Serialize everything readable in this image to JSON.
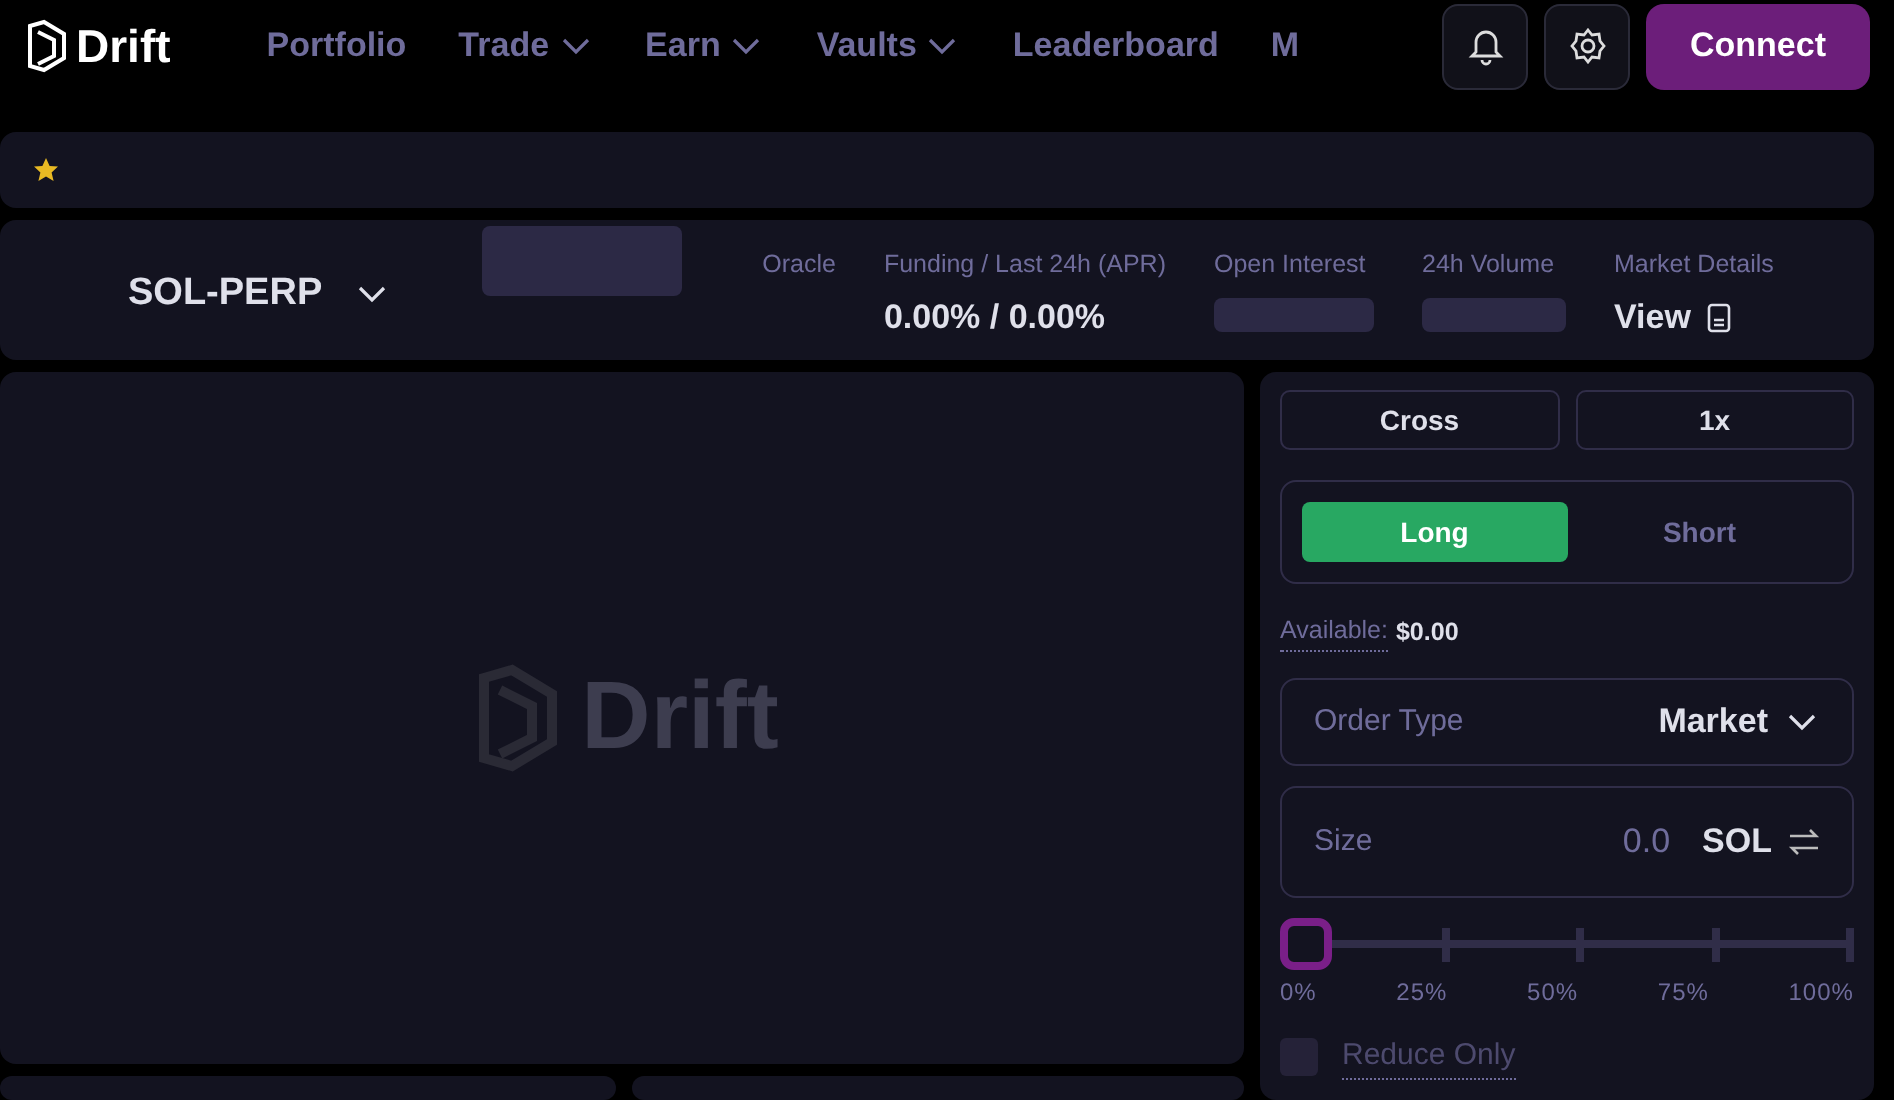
{
  "header": {
    "logo": "Drift",
    "nav": [
      {
        "label": "Portfolio",
        "dropdown": false
      },
      {
        "label": "Trade",
        "dropdown": true
      },
      {
        "label": "Earn",
        "dropdown": true
      },
      {
        "label": "Vaults",
        "dropdown": true
      },
      {
        "label": "Leaderboard",
        "dropdown": false
      },
      {
        "label": "M",
        "dropdown": false
      }
    ],
    "connect": "Connect"
  },
  "favorites_bar": {
    "starred": true
  },
  "market_bar": {
    "market": "SOL-PERP",
    "stats": [
      {
        "label": "Oracle",
        "kind": "empty"
      },
      {
        "label": "Funding / Last 24h (APR)",
        "kind": "value",
        "value": "0.00% / 0.00%"
      },
      {
        "label": "Open Interest",
        "kind": "loading"
      },
      {
        "label": "24h Volume",
        "kind": "loading"
      },
      {
        "label": "Market Details",
        "kind": "link",
        "value": "View"
      }
    ]
  },
  "chart": {
    "watermark": "Drift"
  },
  "trade_panel": {
    "margin_mode": "Cross",
    "leverage": "1x",
    "sides": [
      {
        "label": "Long",
        "selected": true
      },
      {
        "label": "Short",
        "selected": false
      }
    ],
    "available_label": "Available:",
    "available_value": "$0.00",
    "order_type_label": "Order Type",
    "order_type": "Market",
    "size_label": "Size",
    "size_value": "0.0",
    "size_unit": "SOL",
    "slider": {
      "level": 0,
      "ticks": [
        "0%",
        "25%",
        "50%",
        "75%",
        "100%"
      ]
    },
    "reduce_only": {
      "label": "Reduce Only",
      "checked": false
    }
  }
}
